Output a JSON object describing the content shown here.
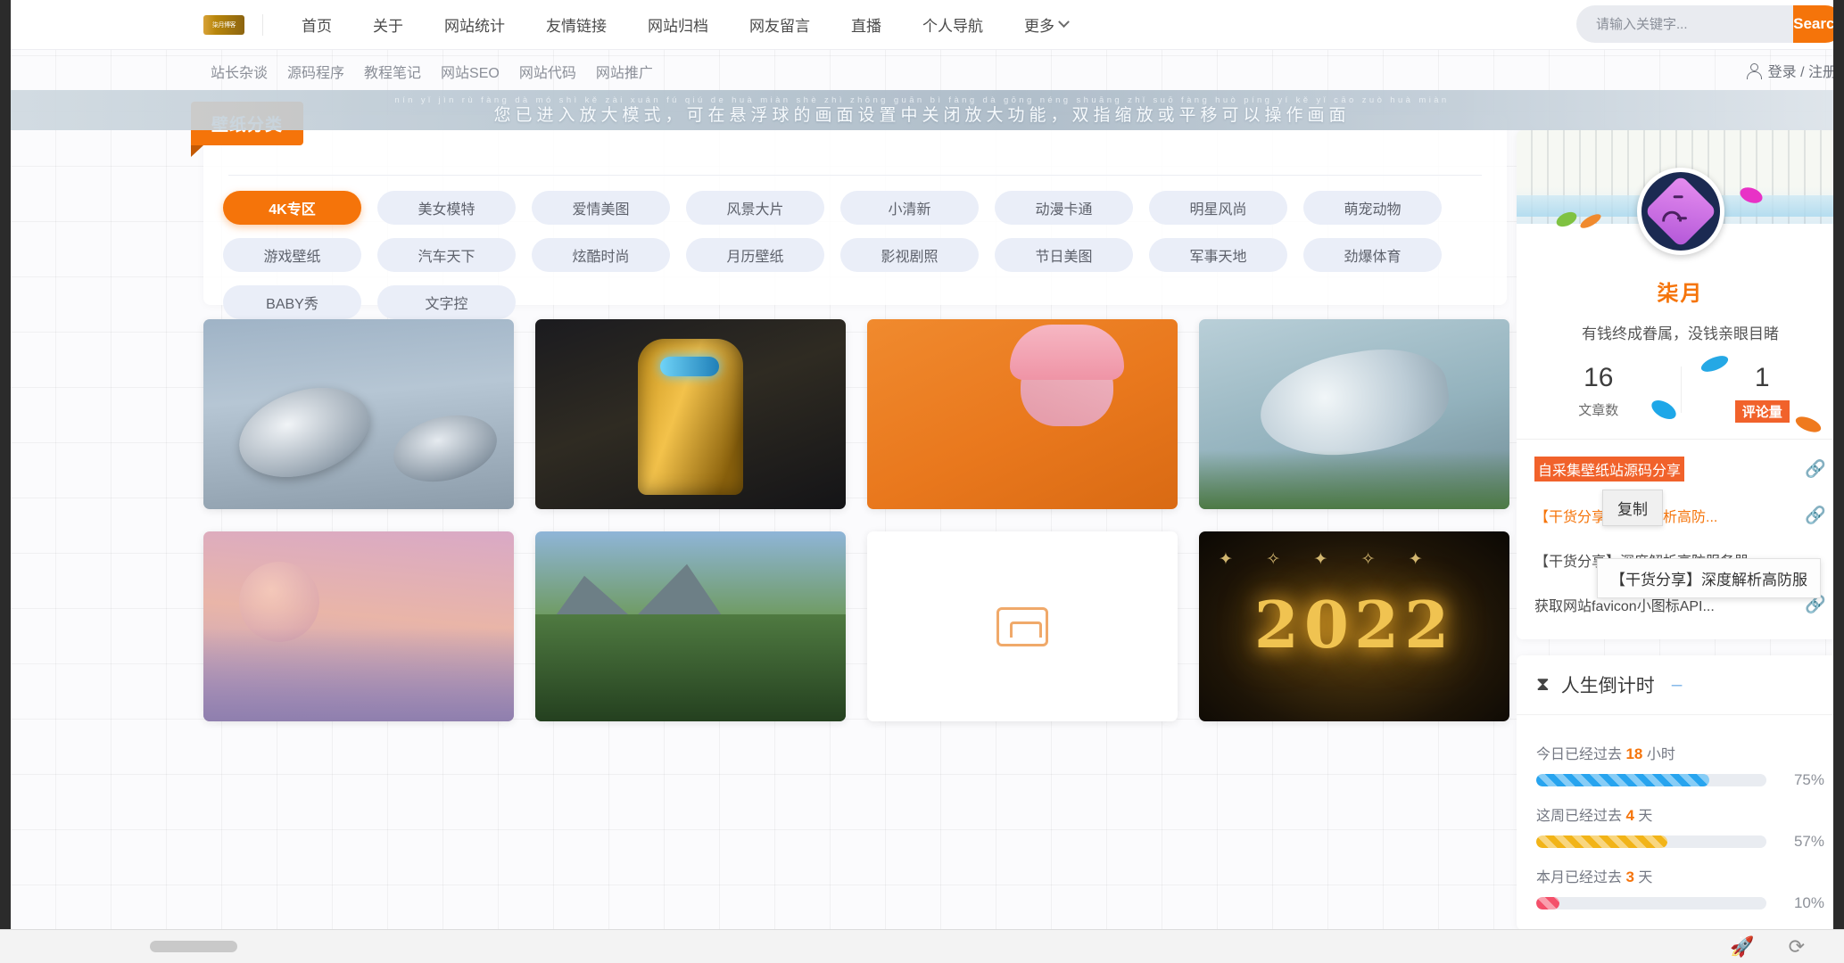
{
  "header": {
    "logo_text": "柒月博客",
    "nav": [
      {
        "label": "首页"
      },
      {
        "label": "关于"
      },
      {
        "label": "网站统计"
      },
      {
        "label": "友情链接"
      },
      {
        "label": "网站归档"
      },
      {
        "label": "网友留言"
      },
      {
        "label": "直播"
      },
      {
        "label": "个人导航"
      },
      {
        "label": "更多"
      }
    ],
    "search": {
      "placeholder": "请输入关键字...",
      "value": "",
      "button": "Search"
    }
  },
  "subnav": {
    "items": [
      {
        "label": "站长杂谈"
      },
      {
        "label": "源码程序"
      },
      {
        "label": "教程笔记"
      },
      {
        "label": "网站SEO"
      },
      {
        "label": "网站代码"
      },
      {
        "label": "网站推广"
      }
    ],
    "account": "登录 / 注册"
  },
  "zoom_banner": {
    "pinyin": "nín  yǐ  jìn  rù  fàng dà  mó shì      kě  zài xuán fú  qiú  de  huà miàn shè  zhì zhōng guān bì  fàng dà  gōng néng    shuāng zhǐ  suō fàng huò píng  yí  kě  yǐ  cāo zuò huà miàn",
    "text": "您已进入放大模式，可在悬浮球的画面设置中关闭放大功能，双指缩放或平移可以操作画面"
  },
  "categories": {
    "flag": "壁纸分类",
    "tags": [
      {
        "label": "4K专区",
        "active": true
      },
      {
        "label": "美女模特",
        "active": false
      },
      {
        "label": "爱情美图",
        "active": false
      },
      {
        "label": "风景大片",
        "active": false
      },
      {
        "label": "小清新",
        "active": false
      },
      {
        "label": "动漫卡通",
        "active": false
      },
      {
        "label": "明星风尚",
        "active": false
      },
      {
        "label": "萌宠动物",
        "active": false
      },
      {
        "label": "游戏壁纸",
        "active": false
      },
      {
        "label": "汽车天下",
        "active": false
      },
      {
        "label": "炫酷时尚",
        "active": false
      },
      {
        "label": "月历壁纸",
        "active": false
      },
      {
        "label": "影视剧照",
        "active": false
      },
      {
        "label": "节日美图",
        "active": false
      },
      {
        "label": "军事天地",
        "active": false
      },
      {
        "label": "劲爆体育",
        "active": false
      },
      {
        "label": "BABY秀",
        "active": false
      },
      {
        "label": "文字控",
        "active": false
      }
    ]
  },
  "thumbnails": [
    {
      "name": "satellite-dish-wallpaper",
      "style": "t-dish"
    },
    {
      "name": "bumblebee-robot-wallpaper",
      "style": "t-bot"
    },
    {
      "name": "pink-hair-model-wallpaper",
      "style": "t-girl"
    },
    {
      "name": "butterfly-wallpaper",
      "style": "t-fly"
    },
    {
      "name": "pink-clouds-wallpaper",
      "style": "t-cloud"
    },
    {
      "name": "mountain-waterfall-wallpaper",
      "style": "t-mount"
    },
    {
      "name": "empty-placeholder-thumb",
      "style": "t-empty"
    },
    {
      "name": "new-year-2022-wallpaper",
      "style": "t-2022"
    }
  ],
  "profile": {
    "name": "柒月",
    "motto": "有钱终成眷属，没钱亲眼目睹",
    "stats": [
      {
        "num": "16",
        "label": "文章数",
        "highlight": false
      },
      {
        "num": "1",
        "label": "评论量",
        "highlight": true
      }
    ]
  },
  "article_links": [
    {
      "text": "自采集壁纸站源码分享",
      "style": "hl"
    },
    {
      "text": "【干货分享】深度解析高防...",
      "style": "orange"
    },
    {
      "text": "【干货分享】深度解析高防服务器",
      "style": "plain"
    },
    {
      "text": "获取网站favicon小图标API...",
      "style": "plain"
    }
  ],
  "popups": {
    "copy": "复制",
    "tooltip": "【干货分享】深度解析高防服"
  },
  "countdown": {
    "title": "人生倒计时",
    "minimize": "–",
    "rows": [
      {
        "label_prefix": "今日已经过去",
        "value": "18",
        "unit": "小时",
        "pct": "75%",
        "color": "blue"
      },
      {
        "label_prefix": "这周已经过去",
        "value": "4",
        "unit": "天",
        "pct": "57%",
        "color": "yellow"
      },
      {
        "label_prefix": "本月已经过去",
        "value": "3",
        "unit": "天",
        "pct": "10%",
        "color": "red"
      }
    ]
  },
  "colors": {
    "accent": "#f5740a",
    "tag_bg": "#eaeef8",
    "highlight": "#f1622b",
    "blue": "#27a4ef",
    "yellow": "#f2b418",
    "red": "#f4506a"
  }
}
